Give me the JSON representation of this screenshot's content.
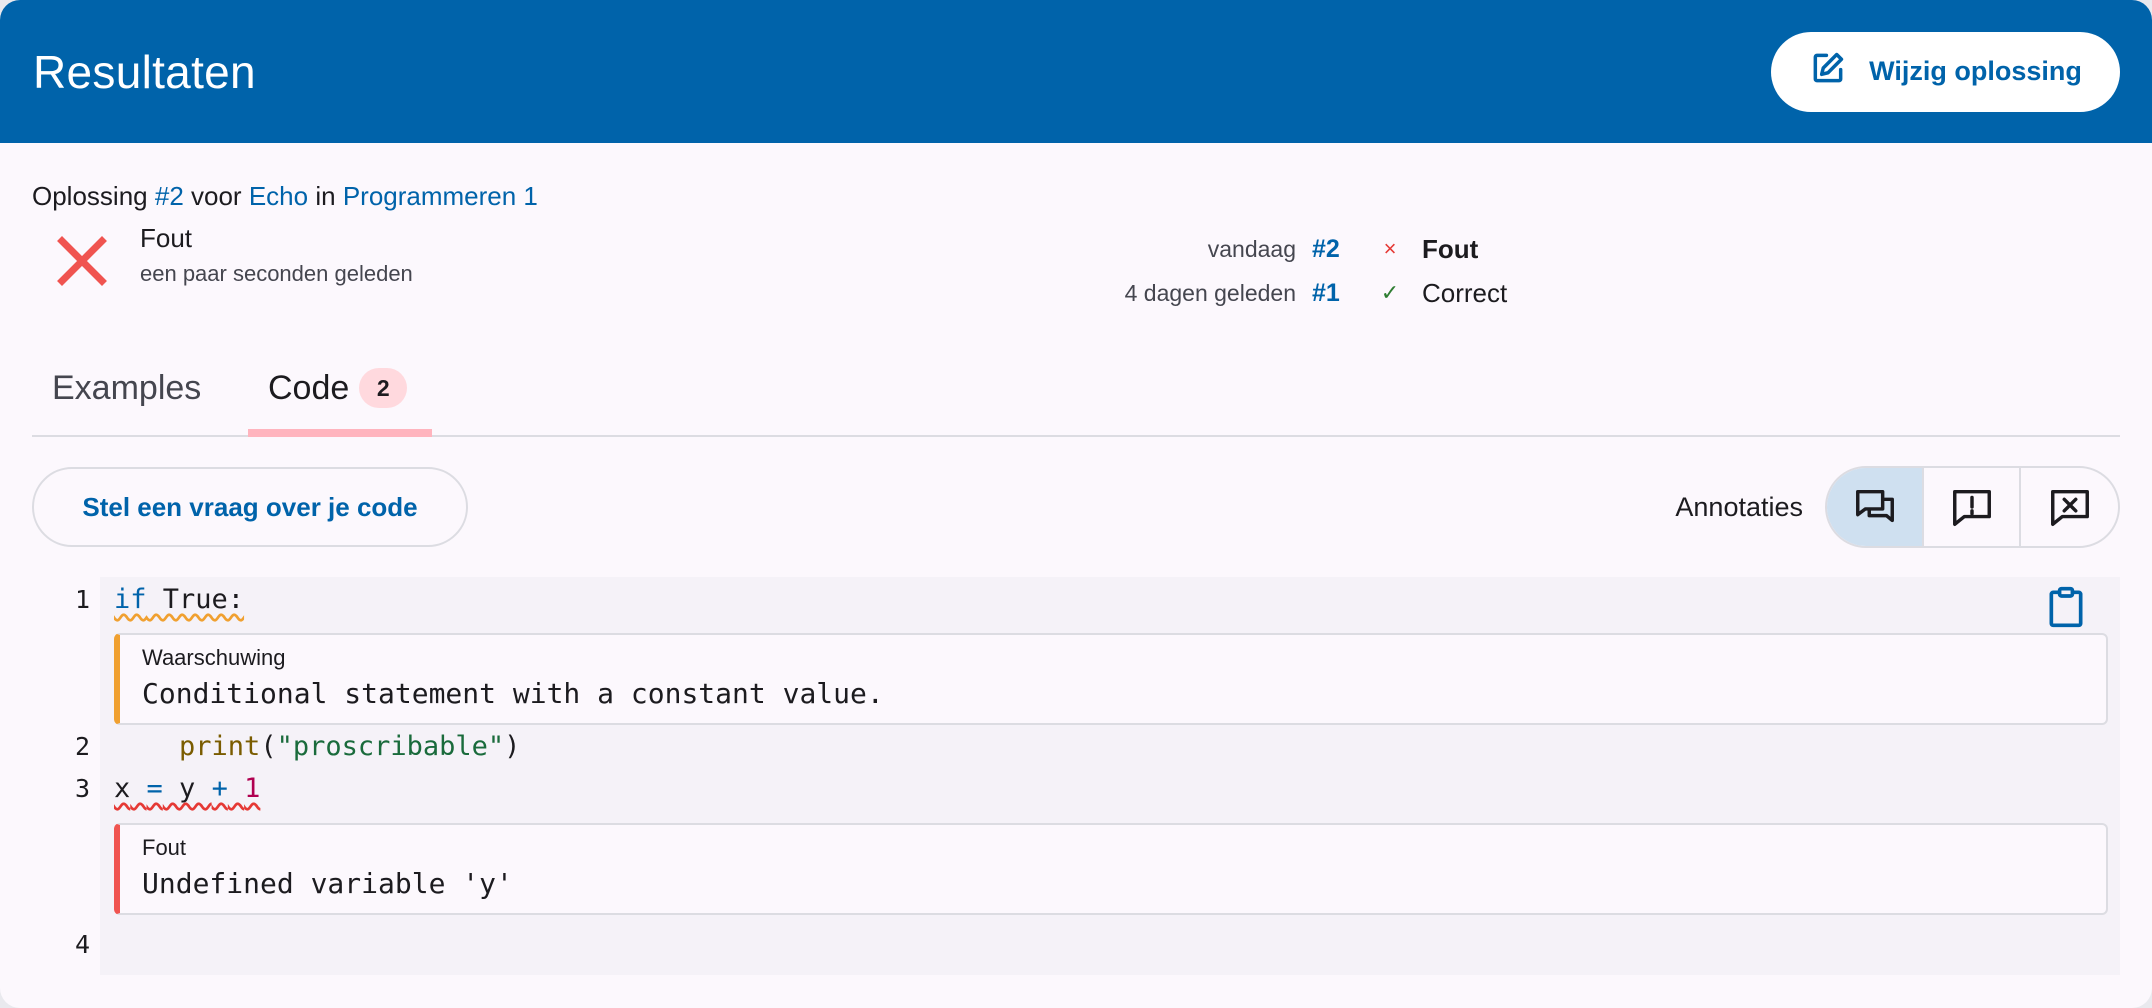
{
  "header": {
    "title": "Resultaten",
    "edit_label": "Wijzig oplossing"
  },
  "breadcrumb": {
    "prefix": "Oplossing",
    "submission": "#2",
    "for": "voor",
    "exercise": "Echo",
    "in": "in",
    "course": "Programmeren 1"
  },
  "status": {
    "title": "Fout",
    "time": "een paar seconden geleden"
  },
  "history": [
    {
      "when": "vandaag",
      "num": "#2",
      "icon": "×",
      "status": "Fout"
    },
    {
      "when": "4 dagen geleden",
      "num": "#1",
      "icon": "✓",
      "status": "Correct"
    }
  ],
  "tabs": {
    "examples": "Examples",
    "code": "Code",
    "code_badge": "2"
  },
  "actions": {
    "ask_label": "Stel een vraag over je code",
    "annotations_label": "Annotaties"
  },
  "code": {
    "lines": [
      {
        "num": "1"
      },
      {
        "num": "2"
      },
      {
        "num": "3"
      },
      {
        "num": "4"
      }
    ],
    "l1_kw": "if",
    "l1_rest": " True:",
    "l2_indent": "    ",
    "l2_fn": "print",
    "l2_open": "(",
    "l2_str": "\"proscribable\"",
    "l2_close": ")",
    "l3_a": "x",
    "l3_b": " ",
    "l3_eq": "=",
    "l3_c": " y ",
    "l3_plus": "+",
    "l3_d": " ",
    "l3_num": "1",
    "annotations": [
      {
        "type": "Waarschuwing",
        "message": "Conditional statement with a constant value."
      },
      {
        "type": "Fout",
        "message": "Undefined variable 'y'"
      }
    ]
  },
  "colors": {
    "brand": "#0063aa",
    "error": "#e53935",
    "warning": "#f0a030",
    "success": "#2e7d32"
  }
}
